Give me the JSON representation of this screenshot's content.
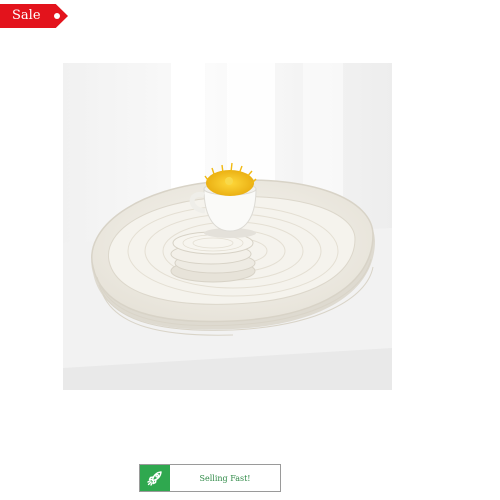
{
  "badge": {
    "label": "Sale",
    "color": "#e3131c"
  },
  "product": {
    "image_subject": "white woven cotton rope tray with stacked coasters and a white cup of yellow flowers",
    "colors": {
      "rope": "#f3f0e8",
      "flowers": "#f4c21a",
      "backdrop": "#f7f7f7"
    }
  },
  "selling_indicator": {
    "icon": "rocket-icon",
    "label": "Selling Fast!",
    "accent": "#2fa84f"
  }
}
